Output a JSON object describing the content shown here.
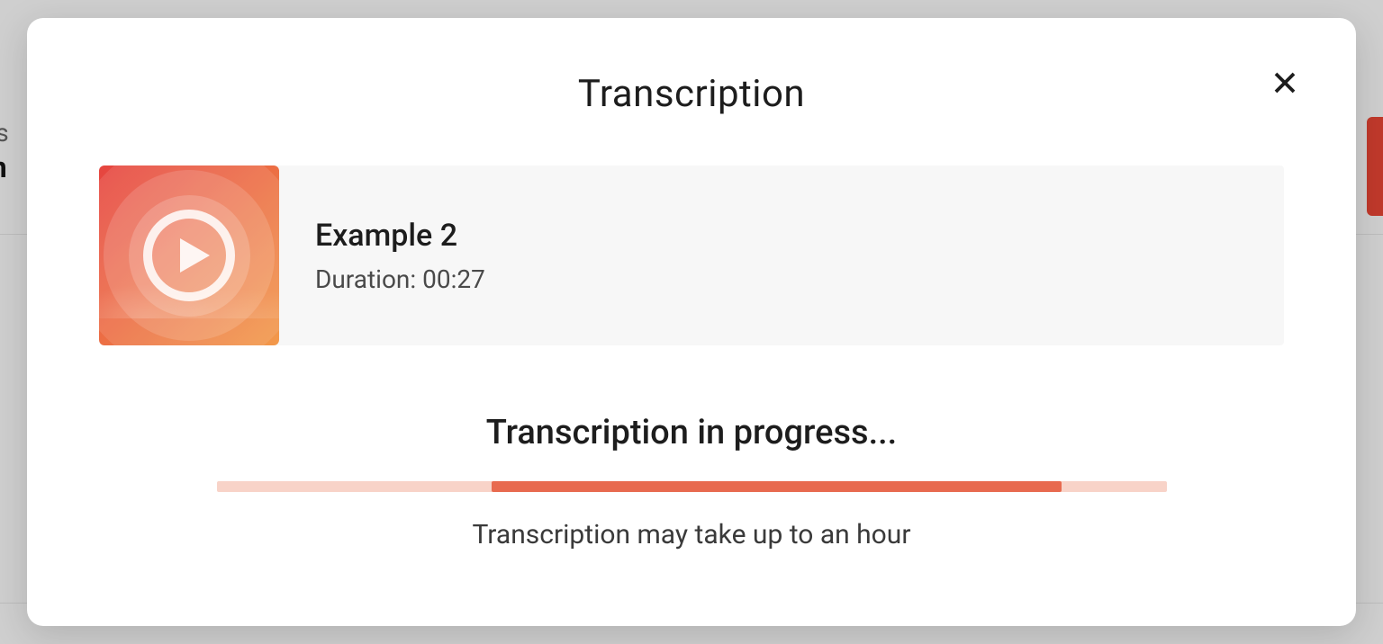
{
  "modal": {
    "title": "Transcription",
    "close_label": "Close"
  },
  "media": {
    "title": "Example 2",
    "duration_label": "Duration: 00:27",
    "thumbnail_icon": "play-icon"
  },
  "status": {
    "title": "Transcription in progress...",
    "hint": "Transcription may take up to an hour",
    "progress": {
      "track_color": "#f8d3c8",
      "fill_color": "#e86a4f",
      "indeterminate": true,
      "fill_start_pct": 29,
      "fill_width_pct": 60
    }
  },
  "background_fragments": {
    "left_line1": "as",
    "left_line2": "m"
  }
}
